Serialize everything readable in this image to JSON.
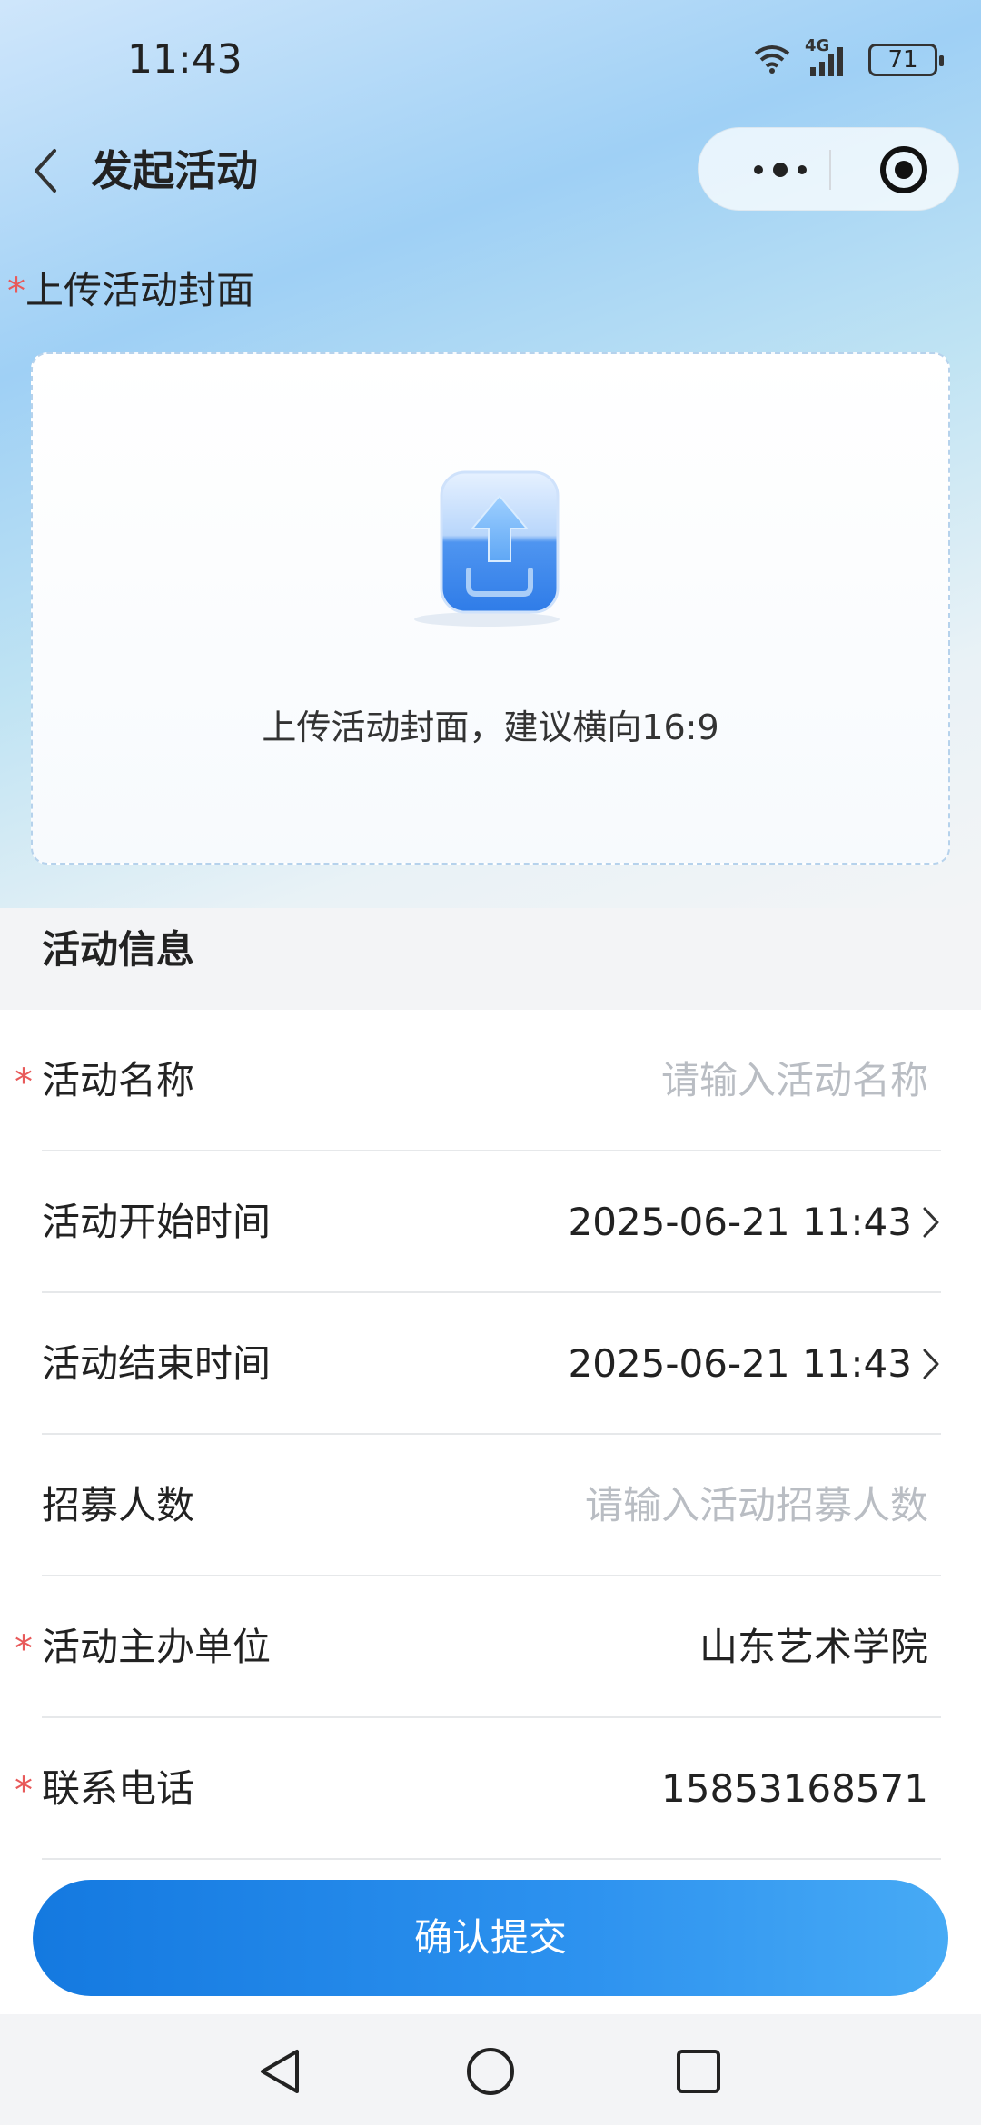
{
  "status_bar": {
    "time": "11:43",
    "network": "4G",
    "battery": "71"
  },
  "nav": {
    "title": "发起活动"
  },
  "cover": {
    "label": "上传活动封面",
    "hint": "上传活动封面，建议横向16:9"
  },
  "info_section": {
    "title": "活动信息"
  },
  "form": {
    "name": {
      "label": "活动名称",
      "placeholder": "请输入活动名称"
    },
    "start_time": {
      "label": "活动开始时间",
      "value": "2025-06-21 11:43"
    },
    "end_time": {
      "label": "活动结束时间",
      "value": "2025-06-21 11:43"
    },
    "recruit": {
      "label": "招募人数",
      "placeholder": "请输入活动招募人数"
    },
    "organizer": {
      "label": "活动主办单位",
      "value": "山东艺术学院"
    },
    "phone": {
      "label": "联系电话",
      "value": "15853168571"
    }
  },
  "submit_label": "确认提交",
  "required_mark": "*",
  "colors": {
    "accent": "#1a82e6",
    "required": "#e85a5a",
    "placeholder": "#b9bdc3"
  }
}
